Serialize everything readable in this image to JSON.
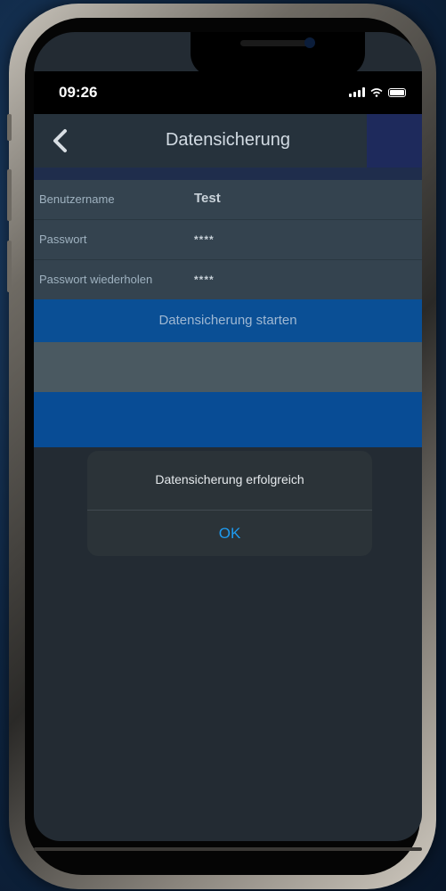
{
  "status_bar": {
    "time": "09:26"
  },
  "navigation": {
    "title": "Datensicherung"
  },
  "form": {
    "rows": [
      {
        "label": "Benutzername",
        "value": "Test"
      },
      {
        "label": "Passwort",
        "value": "****"
      },
      {
        "label": "Passwort wiederholen",
        "value": "****"
      }
    ],
    "start_button_label": "Datensicherung starten"
  },
  "alert": {
    "message": "Datensicherung erfolgreich",
    "ok_label": "OK"
  },
  "colors": {
    "accent_blue": "#0a4f95",
    "alert_button": "#1e9bf0",
    "background": "#232b33"
  }
}
